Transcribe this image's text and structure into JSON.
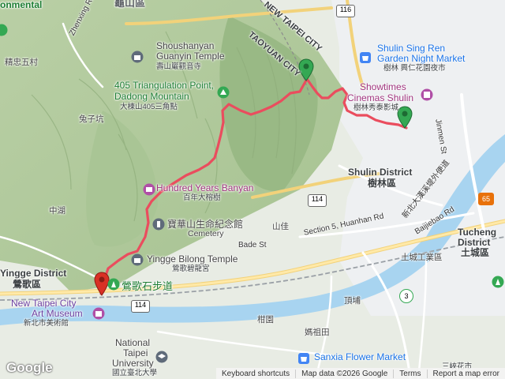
{
  "labels": {
    "top_left": "onmental",
    "guishan_top": "龜山區",
    "zhenxing_rd": "Zhenxing Rd",
    "jingzhong": "精忠五村",
    "shoushanyan_en1": "Shoushanyan",
    "shoushanyan_en2": "Guanyin Temple",
    "shoushanyan_zh": "壽山巖觀音寺",
    "taoyuan_city": "TAOYUAN CITY",
    "new_taipei_city": "NEW TAIPEI CITY",
    "tri_en1": "405 Triangulation Point,",
    "tri_en2": "Dadong Mountain",
    "tri_zh": "大棟山405三角點",
    "ban_yan_en": "Hundred Years Banyan",
    "ban_yan_zh": "百年大榕樹",
    "tuzkeng": "兔子坑",
    "zhonghu": "中湖",
    "baohua_zh": "寶華山生命紀念館",
    "cemetery": "Cemetery",
    "shanjia": "山佳",
    "bade_st": "Bade St",
    "bilong_en": "Yingge Bilong Temple",
    "bilong_zh": "鶯歌碧龍宮",
    "yingge_district": "Yingge District",
    "yingge_zh": "鶯歌區",
    "shibudao": "鶯歌石步道",
    "art_museum_en1": "New Taipei City",
    "art_museum_en2": "Art Museum",
    "art_museum_zh": "新北市美術館",
    "ntpu_en1": "National",
    "ntpu_en2": "Taipei",
    "ntpu_en3": "University",
    "ntpu_zh": "國立臺北大學",
    "ganyuan": "柑園",
    "shulin_district": "Shulin District",
    "shulin_zh": "樹林區",
    "showtimes_en1": "Showtimes",
    "showtimes_en2": "Cinemas Shulin",
    "showtimes_zh": "樹林秀泰影城",
    "night_market_en1": "Shulin Sing Ren",
    "night_market_en2": "Garden Night Market",
    "night_market_zh": "樹林 興仁花園夜市",
    "jinmen_st": "Jinmen St",
    "huanhan_rd": "Section 5, Huanhan Rd",
    "baijiebao_rd": "Baijiebao Rd",
    "xinbei_hwy": "新北大漢溪堤外便道",
    "tucheng_en1": "Tucheng",
    "tucheng_en2": "District",
    "tucheng_zh": "土城區",
    "tucheng_ind": "土城工業區",
    "dingpu": "頂埔",
    "mazutian": "媽祖田",
    "sanxia_flower_en": "Sanxia Flower Market",
    "sanxia_flower_zh": "三峽花市"
  },
  "shields": {
    "r116": "116",
    "r114a": "114",
    "r114b": "114",
    "r65": "65",
    "r3": "3"
  },
  "footer": {
    "google_logo": "Google",
    "shortcuts": "Keyboard shortcuts",
    "map_data": "Map data ©2026 Google",
    "terms": "Terms",
    "report": "Report a map error"
  }
}
